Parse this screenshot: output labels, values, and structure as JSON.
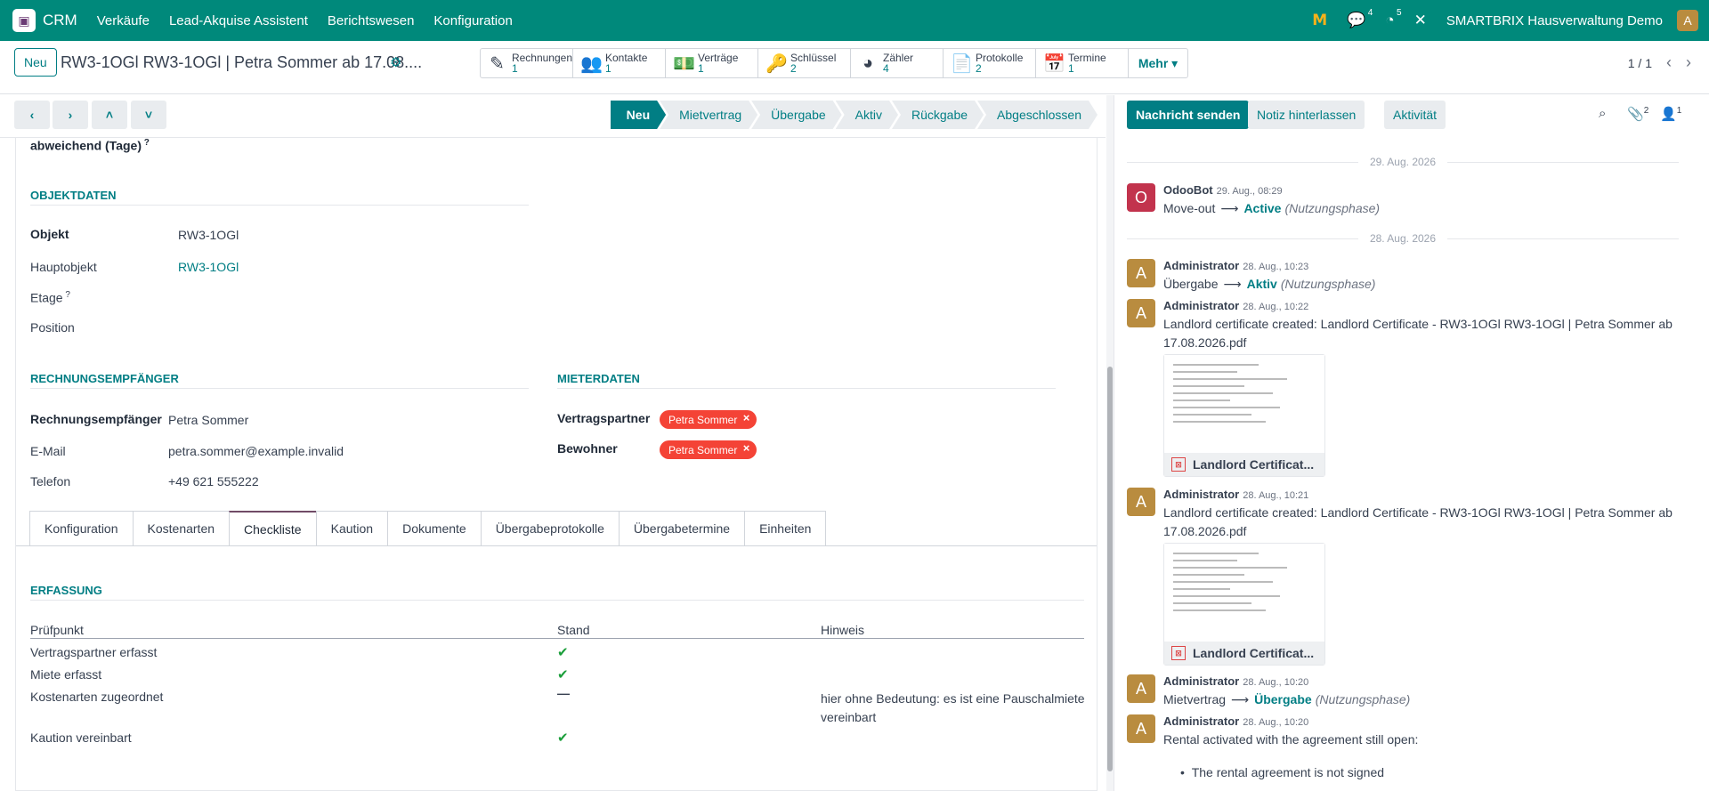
{
  "topbar": {
    "app_name": "CRM",
    "menus": [
      "Verkäufe",
      "Lead-Akquise Assistent",
      "Berichtswesen",
      "Konfiguration"
    ],
    "messages_count": "4",
    "activities_count": "5",
    "company": "SMARTBRIX Hausverwaltung Demo",
    "avatar": "A"
  },
  "control": {
    "new_label": "Neu",
    "title": "RW3-1OGl RW3-1OGl | Petra Sommer ab 17.08....",
    "smart_buttons": [
      {
        "label": "Rechnungen",
        "count": "1"
      },
      {
        "label": "Kontakte",
        "count": "1"
      },
      {
        "label": "Verträge",
        "count": "1"
      },
      {
        "label": "Schlüssel",
        "count": "2"
      },
      {
        "label": "Zähler",
        "count": "4"
      },
      {
        "label": "Protokolle",
        "count": "2"
      },
      {
        "label": "Termine",
        "count": "1"
      }
    ],
    "more_label": "Mehr",
    "pager": "1 / 1"
  },
  "stages": [
    "Neu",
    "Mietvertrag",
    "Übergabe",
    "Aktiv",
    "Rückgabe",
    "Abgeschlossen"
  ],
  "form": {
    "abweichend": "abweichend (Tage)",
    "objekt_section": "OBJEKTDATEN",
    "objekt_label": "Objekt",
    "objekt_value": "RW3-1OGl",
    "hauptobjekt_label": "Hauptobjekt",
    "hauptobjekt_value": "RW3-1OGl",
    "etage_label": "Etage",
    "position_label": "Position",
    "rechnung_section": "RECHNUNGSEMPFÄNGER",
    "rechnung_label": "Rechnungsempfänger",
    "rechnung_value": "Petra Sommer",
    "email_label": "E-Mail",
    "email_value": "petra.sommer@example.invalid",
    "telefon_label": "Telefon",
    "telefon_value": "+49 621 555222",
    "mieter_section": "MIETERDATEN",
    "vertragspartner_label": "Vertragspartner",
    "vertragspartner_tag": "Petra Sommer",
    "bewohner_label": "Bewohner",
    "bewohner_tag": "Petra Sommer"
  },
  "tabs": [
    "Konfiguration",
    "Kostenarten",
    "Checkliste",
    "Kaution",
    "Dokumente",
    "Übergabeprotokolle",
    "Übergabetermine",
    "Einheiten"
  ],
  "checklist": {
    "section": "ERFASSUNG",
    "headers": {
      "pruefpunkt": "Prüfpunkt",
      "stand": "Stand",
      "hinweis": "Hinweis"
    },
    "rows": [
      {
        "item": "Vertragspartner erfasst",
        "status": "check",
        "note": ""
      },
      {
        "item": "Miete erfasst",
        "status": "check",
        "note": ""
      },
      {
        "item": "Kostenarten zugeordnet",
        "status": "dash",
        "note": "hier ohne Bedeutung: es ist eine Pauschalmiete vereinbart"
      },
      {
        "item": "Kaution vereinbart",
        "status": "check",
        "note": ""
      }
    ]
  },
  "chatter": {
    "send_label": "Nachricht senden",
    "note_label": "Notiz hinterlassen",
    "activity_label": "Aktivität",
    "attachments_count": "2",
    "followers_count": "1",
    "date1": "29. Aug. 2026",
    "date2": "28. Aug. 2026",
    "messages": [
      {
        "author": "OdooBot",
        "time": "29. Aug., 08:29",
        "from": "Move-out",
        "to": "Active",
        "phase": "(Nutzungsphase)",
        "avatar": "O"
      },
      {
        "author": "Administrator",
        "time": "28. Aug., 10:23",
        "from": "Übergabe",
        "to": "Aktiv",
        "phase": "(Nutzungsphase)",
        "avatar": "A"
      },
      {
        "author": "Administrator",
        "time": "28. Aug., 10:22",
        "text": "Landlord certificate created: Landlord Certificate - RW3-1OGl RW3-1OGl | Petra Sommer ab 17.08.2026.pdf",
        "attachment": "Landlord Certificat...",
        "avatar": "A"
      },
      {
        "author": "Administrator",
        "time": "28. Aug., 10:21",
        "text": "Landlord certificate created: Landlord Certificate - RW3-1OGl RW3-1OGl | Petra Sommer ab 17.08.2026.pdf",
        "attachment": "Landlord Certificat...",
        "avatar": "A"
      },
      {
        "author": "Administrator",
        "time": "28. Aug., 10:20",
        "from": "Mietvertrag",
        "to": "Übergabe",
        "phase": "(Nutzungsphase)",
        "avatar": "A"
      },
      {
        "author": "Administrator",
        "time": "28. Aug., 10:20",
        "text": "Rental activated with the agreement still open:",
        "bullet": "The rental agreement is not signed",
        "avatar": "A"
      }
    ]
  },
  "colors": {
    "primary": "#017e84",
    "navbar": "#00897b",
    "tag": "#f44336",
    "avatar_admin": "#b98c3f",
    "avatar_bot": "#c2334d"
  }
}
